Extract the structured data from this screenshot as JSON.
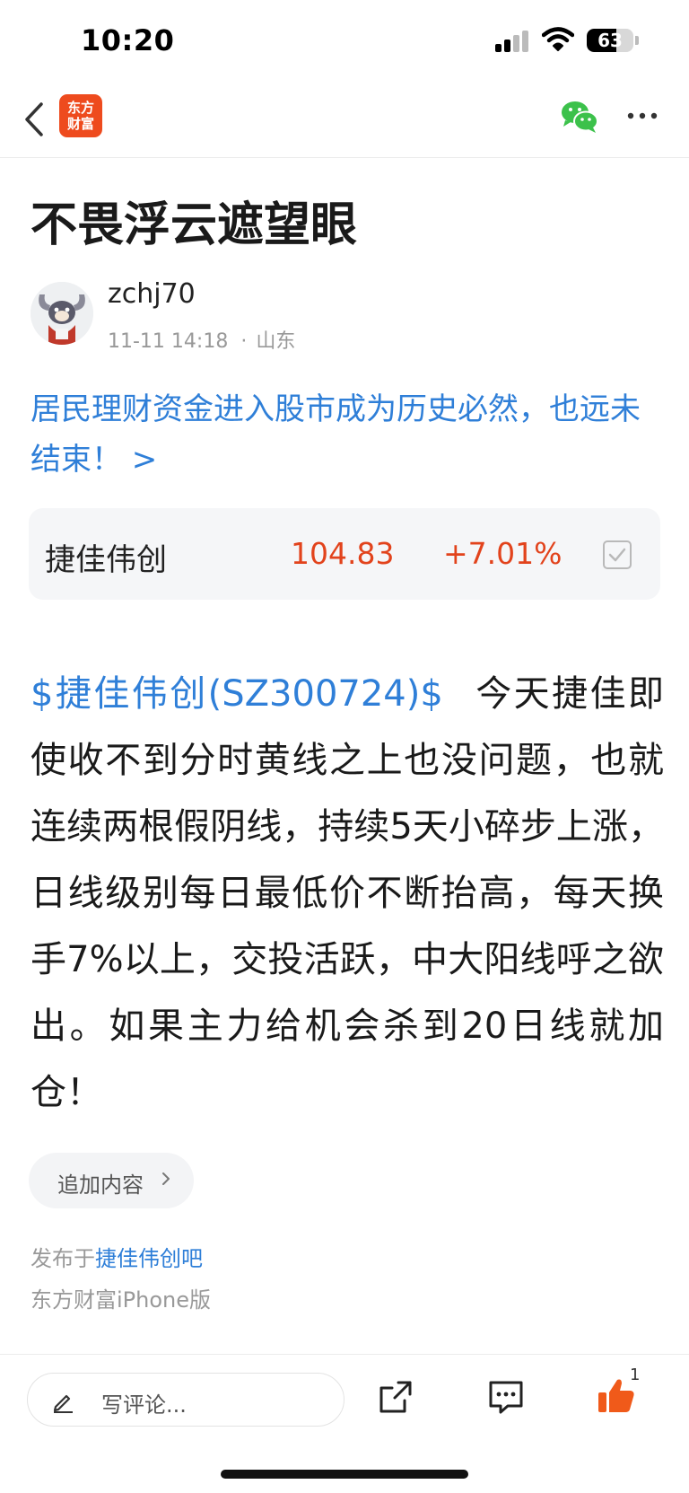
{
  "status_bar": {
    "time": "10:20",
    "battery": "63",
    "battery_level": 0.63
  },
  "nav": {
    "logo_text_line1": "东方",
    "logo_text_line2": "财富"
  },
  "article": {
    "title": "不畏浮云遮望眼",
    "author": "zchj70",
    "timestamp": "11-11 14:18",
    "location": "山东",
    "promo_link": "居民理财资金进入股市成为历史必然，也远未结束！ >",
    "stock_card": {
      "name": "捷佳伟创",
      "price": "104.83",
      "change": "+7.01%"
    },
    "stock_tag": "$捷佳伟创(SZ300724)$",
    "body": "今天捷佳即使收不到分时黄线之上也没问题，也就连续两根假阴线，持续5天小碎步上涨，日线级别每日最低价不断抬高，每天换手7%以上，交投活跃，中大阳线呼之欲出。如果主力给机会杀到20日线就加仓！",
    "add_content_label": "追加内容",
    "published_prefix": "发布于",
    "published_bar": "捷佳伟创吧",
    "platform": "东方财富iPhone版"
  },
  "bottom_bar": {
    "comment_placeholder": "写评论...",
    "like_count": "1"
  },
  "colors": {
    "accent_blue": "#2f7fd8",
    "price_red": "#e2431c",
    "logo_orange": "#ee4b1e",
    "like_orange": "#f05a1a"
  }
}
